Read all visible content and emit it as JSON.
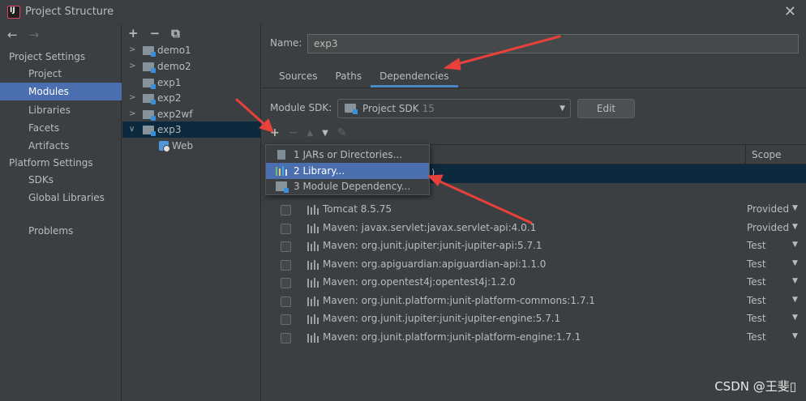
{
  "window": {
    "title": "Project Structure"
  },
  "leftnav": {
    "project_settings_header": "Project Settings",
    "project_settings_items": [
      "Project",
      "Modules",
      "Libraries",
      "Facets",
      "Artifacts"
    ],
    "platform_settings_header": "Platform Settings",
    "platform_settings_items": [
      "SDKs",
      "Global Libraries"
    ],
    "problems_label": "Problems",
    "selected": "Modules"
  },
  "tree": {
    "toolbar": [
      "+",
      "−",
      "⧉"
    ],
    "items": [
      "demo1",
      "demo2",
      "exp1",
      "exp2",
      "exp2wf",
      "exp3",
      "Web"
    ],
    "selected": "exp3"
  },
  "module": {
    "name_label": "Name:",
    "name_value": "exp3",
    "tabs": [
      "Sources",
      "Paths",
      "Dependencies"
    ],
    "active_tab": "Dependencies",
    "sdk_label": "Module SDK:",
    "sdk_value": "Project SDK",
    "sdk_version": "15",
    "edit_label": "Edit"
  },
  "dependencies": {
    "scope_header": "Scope",
    "selected_row_fragment": ")",
    "rows": [
      {
        "name": "Tomcat 8.5.75",
        "scope": "Provided"
      },
      {
        "name": "Maven: javax.servlet:javax.servlet-api:4.0.1",
        "scope": "Provided"
      },
      {
        "name": "Maven: org.junit.jupiter:junit-jupiter-api:5.7.1",
        "scope": "Test"
      },
      {
        "name": "Maven: org.apiguardian:apiguardian-api:1.1.0",
        "scope": "Test"
      },
      {
        "name": "Maven: org.opentest4j:opentest4j:1.2.0",
        "scope": "Test"
      },
      {
        "name": "Maven: org.junit.platform:junit-platform-commons:1.7.1",
        "scope": "Test"
      },
      {
        "name": "Maven: org.junit.jupiter:junit-jupiter-engine:5.7.1",
        "scope": "Test"
      },
      {
        "name": "Maven: org.junit.platform:junit-platform-engine:1.7.1",
        "scope": "Test"
      }
    ]
  },
  "add_popup": {
    "items": [
      "1  JARs or Directories...",
      "2  Library...",
      "3  Module Dependency..."
    ],
    "selected": "2  Library..."
  },
  "watermark": "CSDN @王斐▯",
  "colors": {
    "background": "#3c3f41",
    "selection": "#4b6eaf",
    "tree_selection": "#0d293e",
    "annotation_arrow": "#e8403a"
  }
}
